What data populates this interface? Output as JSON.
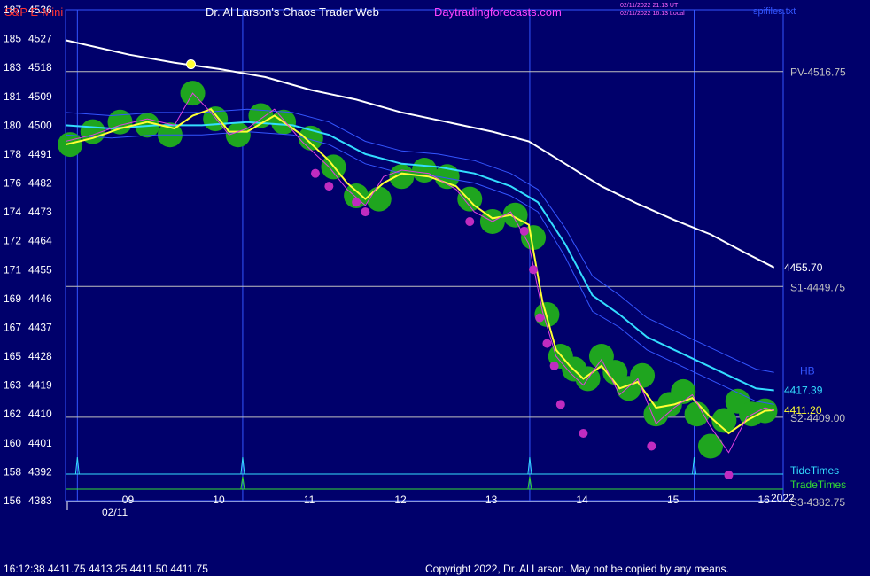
{
  "header": {
    "symbol": "S&P E-Mini",
    "title": "Dr. Al Larson's Chaos Trader Web",
    "site": "Daytradingforecasts.com",
    "stamp_utc": "02/11/2022 21:13 UT",
    "stamp_local": "02/11/2022 16:13 Local",
    "file": "spifiles.txt"
  },
  "footer": {
    "quote": "16:12:38  4411.75 4413.25 4411.50 4411.75",
    "copyright": "Copyright 2022, Dr. Al Larson. May not be copied by any means."
  },
  "chart_data": {
    "type": "line",
    "x_axis": {
      "range": [
        8.3,
        16.2
      ],
      "ticks": [
        "09",
        "10",
        "11",
        "12",
        "13",
        "14",
        "15",
        "16"
      ],
      "tick_values": [
        9,
        10,
        11,
        12,
        13,
        14,
        15,
        16
      ],
      "date_label": "02/11",
      "year_label": "2022"
    },
    "y_axis": {
      "range": [
        4383,
        4536
      ],
      "ticks": [
        {
          "left": "187",
          "price": "4536"
        },
        {
          "left": "185",
          "price": "4527"
        },
        {
          "left": "183",
          "price": "4518"
        },
        {
          "left": "181",
          "price": "4509"
        },
        {
          "left": "180",
          "price": "4500"
        },
        {
          "left": "178",
          "price": "4491"
        },
        {
          "left": "176",
          "price": "4482"
        },
        {
          "left": "174",
          "price": "4473"
        },
        {
          "left": "172",
          "price": "4464"
        },
        {
          "left": "171",
          "price": "4455"
        },
        {
          "left": "169",
          "price": "4446"
        },
        {
          "left": "167",
          "price": "4437"
        },
        {
          "left": "165",
          "price": "4428"
        },
        {
          "left": "163",
          "price": "4419"
        },
        {
          "left": "162",
          "price": "4410"
        },
        {
          "left": "160",
          "price": "4401"
        },
        {
          "left": "158",
          "price": "4392"
        },
        {
          "left": "156",
          "price": "4383"
        }
      ]
    },
    "levels": [
      {
        "label": "PV-4516.75",
        "value": 4516.75
      },
      {
        "label": "S1-4449.75",
        "value": 4449.75
      },
      {
        "label": "S2-4409.00",
        "value": 4409.0
      },
      {
        "label": "S3-4382.75",
        "value": 4382.75
      }
    ],
    "end_labels": [
      {
        "label": "4455.70",
        "value": 4455.7,
        "series": "white"
      },
      {
        "label": "4417.39",
        "value": 4417.39,
        "series": "cyan"
      },
      {
        "label": "4411.20",
        "value": 4411.2,
        "series": "yellow"
      },
      {
        "label": "HB",
        "value": 4423.5,
        "series": "blue"
      }
    ],
    "timing_lines": {
      "tide_label": "TideTimes",
      "trade_label": "TradeTimes",
      "tide_times": [
        8.43,
        10.25,
        13.41,
        15.22
      ],
      "trade_times": [
        10.25,
        13.41
      ],
      "vertical_markers": [
        8.43,
        10.25,
        13.41,
        15.22
      ]
    },
    "series": [
      {
        "key": "white",
        "color": "#ffffff",
        "x": [
          8.3,
          9.0,
          9.5,
          10.0,
          10.5,
          11.0,
          11.5,
          12.0,
          12.5,
          13.0,
          13.4,
          13.8,
          14.2,
          14.6,
          15.0,
          15.4,
          15.8,
          16.1
        ],
        "y": [
          4526.5,
          4522,
          4519.5,
          4517.5,
          4515,
          4511,
          4508,
          4504,
          4501,
          4498,
          4495,
          4488,
          4481,
          4475.5,
          4470.5,
          4466,
          4460,
          4455.7
        ]
      },
      {
        "key": "cyan",
        "color": "#33ddff",
        "x": [
          8.3,
          8.8,
          9.3,
          9.8,
          10.3,
          10.8,
          11.2,
          11.6,
          12.0,
          12.4,
          12.8,
          13.2,
          13.5,
          13.8,
          14.1,
          14.4,
          14.7,
          15.0,
          15.3,
          15.6,
          15.9,
          16.1
        ],
        "y": [
          4500,
          4499,
          4500,
          4500,
          4501,
          4500,
          4497,
          4491,
          4488,
          4487,
          4485,
          4481,
          4476,
          4463,
          4447,
          4441,
          4434,
          4430,
          4426,
          4422,
          4418,
          4417.39
        ]
      },
      {
        "key": "blue_upper",
        "color": "#3355ff",
        "x": [
          8.3,
          8.8,
          9.3,
          9.8,
          10.3,
          10.8,
          11.2,
          11.6,
          12.0,
          12.4,
          12.8,
          13.2,
          13.5,
          13.8,
          14.1,
          14.4,
          14.7,
          15.0,
          15.3,
          15.6,
          15.9,
          16.1
        ],
        "y": [
          4504,
          4503,
          4504,
          4504,
          4505,
          4504,
          4501,
          4495,
          4492,
          4491,
          4489,
          4485,
          4480,
          4468,
          4453,
          4447,
          4440,
          4436,
          4432,
          4428,
          4424,
          4423
        ]
      },
      {
        "key": "blue_lower",
        "color": "#3355ff",
        "x": [
          8.3,
          8.8,
          9.3,
          9.8,
          10.3,
          10.8,
          11.2,
          11.6,
          12.0,
          12.4,
          12.8,
          13.2,
          13.5,
          13.8,
          14.1,
          14.4,
          14.7,
          15.0,
          15.3,
          15.6,
          15.9,
          16.1
        ],
        "y": [
          4497,
          4496,
          4497,
          4497,
          4498,
          4497,
          4494,
          4488,
          4485,
          4484,
          4482,
          4478,
          4473,
          4459,
          4442,
          4437,
          4430,
          4426,
          4422,
          4418,
          4414,
          4413
        ]
      },
      {
        "key": "yellow",
        "color": "#ffff33",
        "x": [
          8.3,
          8.6,
          8.9,
          9.2,
          9.5,
          9.7,
          9.9,
          10.1,
          10.3,
          10.6,
          10.9,
          11.2,
          11.4,
          11.6,
          11.8,
          12.0,
          12.3,
          12.6,
          12.8,
          13.0,
          13.2,
          13.4,
          13.55,
          13.7,
          13.85,
          14.0,
          14.2,
          14.4,
          14.6,
          14.8,
          15.0,
          15.2,
          15.4,
          15.6,
          15.8,
          16.0,
          16.1
        ],
        "y": [
          4494,
          4496,
          4499,
          4501,
          4499,
          4503,
          4505,
          4498,
          4498,
          4503,
          4497,
          4489,
          4482,
          4477,
          4482,
          4485,
          4484,
          4481,
          4475,
          4471,
          4472,
          4469,
          4445,
          4430,
          4425,
          4421,
          4425,
          4418,
          4420,
          4412,
          4413,
          4415,
          4409,
          4404,
          4408,
          4411,
          4411.2
        ]
      },
      {
        "key": "magenta",
        "color": "#e040e0",
        "x": [
          8.3,
          8.6,
          8.9,
          9.2,
          9.5,
          9.7,
          9.9,
          10.1,
          10.3,
          10.6,
          10.9,
          11.2,
          11.4,
          11.6,
          11.8,
          12.0,
          12.3,
          12.6,
          12.8,
          13.0,
          13.2,
          13.4,
          13.55,
          13.7,
          13.85,
          14.0,
          14.2,
          14.4,
          14.6,
          14.8,
          15.0,
          15.2,
          15.4,
          15.6,
          15.8,
          16.0,
          16.1
        ],
        "y": [
          4495,
          4497,
          4500,
          4502,
          4500,
          4510,
          4504,
          4497,
          4499,
          4505,
          4495,
          4487,
          4480,
          4475,
          4484,
          4486,
          4485,
          4480,
          4473,
          4470,
          4473,
          4463,
          4442,
          4428,
          4423,
          4419,
          4427,
          4416,
          4421,
          4407,
          4412,
          4416,
          4406,
          4398,
          4409,
          4412,
          4411
        ]
      }
    ],
    "green_dots": {
      "x": [
        8.35,
        8.6,
        8.9,
        9.2,
        9.45,
        9.7,
        9.95,
        10.2,
        10.45,
        10.7,
        11.0,
        11.25,
        11.5,
        11.75,
        12.0,
        12.25,
        12.5,
        12.75,
        13.0,
        13.25,
        13.45,
        13.6,
        13.75,
        13.9,
        14.05,
        14.2,
        14.35,
        14.5,
        14.65,
        14.8,
        14.95,
        15.1,
        15.25,
        15.4,
        15.55,
        15.7,
        15.85,
        16.0
      ],
      "y": [
        4494,
        4498,
        4501,
        4500,
        4497,
        4510,
        4502,
        4497,
        4503,
        4501,
        4496,
        4487,
        4478,
        4477,
        4484,
        4486,
        4484,
        4477,
        4470,
        4472,
        4465,
        4441,
        4428,
        4424,
        4421,
        4428,
        4423,
        4418,
        4422,
        4410,
        4413,
        4417,
        4410,
        4400,
        4408,
        4414,
        4410,
        4411
      ]
    },
    "magenta_dots": {
      "x": [
        11.05,
        11.2,
        11.5,
        11.6,
        12.75,
        13.35,
        13.45,
        13.52,
        13.6,
        13.68,
        13.75,
        14.0,
        14.75,
        15.6
      ],
      "y": [
        4485,
        4481,
        4476,
        4473,
        4470,
        4467,
        4455,
        4440,
        4432,
        4425,
        4413,
        4404,
        4400,
        4391
      ]
    },
    "highlight_dot": {
      "x": 9.68,
      "y": 4519
    }
  }
}
